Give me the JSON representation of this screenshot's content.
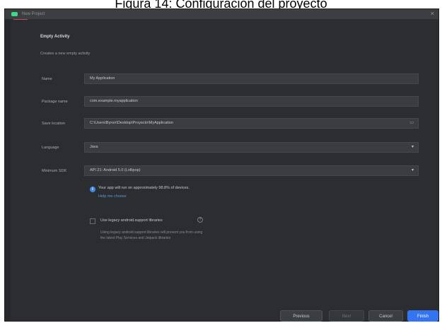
{
  "caption": "Figura 14: Configuración del proyecto",
  "window": {
    "title": "New Project",
    "close_glyph": "×"
  },
  "form": {
    "heading": "Empty Activity",
    "subtext": "Creates a new empty activity",
    "name": {
      "label": "Name",
      "value": "My Application"
    },
    "package": {
      "label": "Package name",
      "value": "com.example.myapplication"
    },
    "save_location": {
      "label": "Save location",
      "value": "C:\\Users\\Byron\\Desktop\\Proyecto\\MyApplication"
    },
    "language": {
      "label": "Language",
      "value": "Java"
    },
    "min_sdk": {
      "label": "Minimum SDK",
      "value": "API 21: Android 5.0 (Lollipop)"
    },
    "info": {
      "text": "Your app will run on approximately 98.8% of devices.",
      "link": "Help me choose"
    },
    "legacy": {
      "label": "Use legacy android.support libraries",
      "desc1": "Using legacy android.support libraries will prevent you from using",
      "desc2": "the latest Play Services and Jetpack libraries"
    }
  },
  "buttons": {
    "previous": "Previous",
    "next": "Next",
    "cancel": "Cancel",
    "finish": "Finish"
  },
  "icons": {
    "folder": "folder-icon",
    "dropdown": "chevron-down-icon",
    "info": "info-icon"
  }
}
